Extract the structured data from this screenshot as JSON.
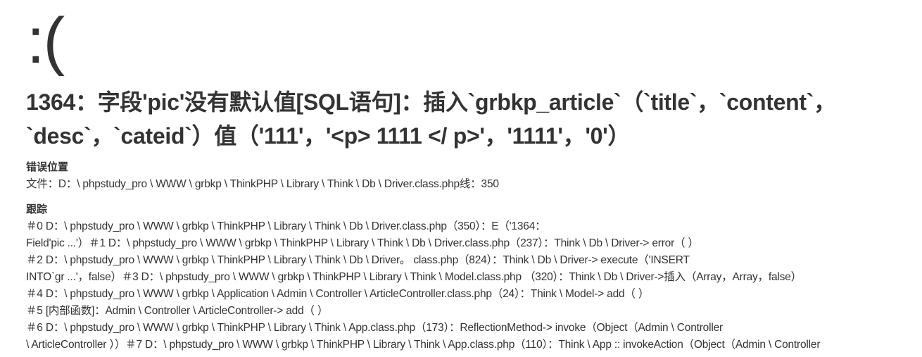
{
  "face": ":(",
  "error_message": "1364：字段'pic'没有默认值[SQL语句]：插入`grbkp_article`（`title`，`content`，`desc`，`cateid`）值（'111'，'<p> 1111 </ p>'，'1111'，'0'）",
  "error_message_lines": [
    "1364：字段'pic'没有默认值[SQL语句]：插入`grbkp_article`（`title`，`content`，",
    "`desc`，`cateid`）值（'111'，'<p> 1111 </ p>'，'1111'，'0'）"
  ],
  "location": {
    "title": "错误位置",
    "content": "文件：D：\\ phpstudy_pro \\ WWW \\ grbkp \\ ThinkPHP \\ Library \\ Think \\ Db \\ Driver.class.php线：350"
  },
  "trace": {
    "title": "跟踪",
    "lines": [
      "＃0 D：\\ phpstudy_pro \\ WWW \\ grbkp \\ ThinkPHP \\ Library \\ Think \\ Db \\ Driver.class.php（350）：E（'1364：",
      "Field'pic ...'）＃1 D：\\ phpstudy_pro \\ WWW \\ grbkp \\ ThinkPHP \\ Library \\ Think \\ Db \\ Driver.class.php（237）：Think \\ Db \\ Driver-> error（ ）",
      "＃2 D：\\ phpstudy_pro \\ WWW \\ grbkp \\ ThinkPHP \\ Library \\ Think \\ Db \\ Driver。 class.php（824）：Think \\ Db \\ Driver-> execute（'INSERT",
      "INTO`gr ...'，false）＃3 D：\\ phpstudy_pro \\ WWW \\ grbkp \\ ThinkPHP \\ Library \\ Think \\ Model.class.php （320）：Think \\ Db \\ Driver->插入（Array，Array，false）",
      "＃4 D：\\ phpstudy_pro \\ WWW \\ grbkp \\ Application \\ Admin \\ Controller \\ ArticleController.class.php（24）：Think \\ Model-> add（ ）",
      "＃5 [内部函数]：Admin \\ Controller \\ ArticleController-> add（ ）",
      "＃6 D：\\ phpstudy_pro \\ WWW \\ grbkp \\ ThinkPHP \\ Library \\ Think \\ App.class.php（173）：ReflectionMethod-> invoke（Object（Admin \\ Controller",
      "\\ ArticleController ））＃7 D：\\ phpstudy_pro \\ WWW \\ grbkp \\ ThinkPHP \\ Library \\ Think \\ App.class.php（110）：Think \\ App :: invokeAction（Object（Admin \\ Controller"
    ]
  }
}
